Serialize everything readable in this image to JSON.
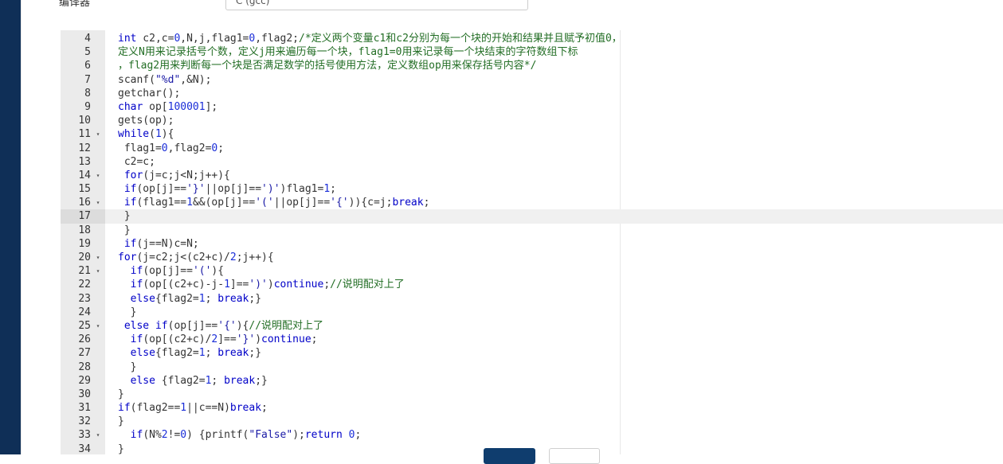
{
  "header": {
    "label": "编译器",
    "compiler_value": "C (gcc)"
  },
  "editor": {
    "active_line": "17",
    "lines": [
      {
        "n": "4",
        "fold": false,
        "html": "<span class=\"kw\">int</span> c2,c=<span class=\"num\">0</span>,N,j,flag1=<span class=\"num\">0</span>,flag2;<span class=\"cm\">/*定义两个变量c1和c2分别为每一个块的开始和结果并且赋予初值0，</span>"
      },
      {
        "n": "5",
        "fold": false,
        "html": "<span class=\"cm\">定义N用来记录括号个数，定义j用来遍历每一个块，flag1=0用来记录每一个块结束的字符数组下标</span>"
      },
      {
        "n": "6",
        "fold": false,
        "html": "<span class=\"cm\">，flag2用来判断每一个块是否满足数学的括号使用方法，定义数组op用来保存括号内容*/</span>"
      },
      {
        "n": "7",
        "fold": false,
        "html": "scanf(<span class=\"str\">\"%d\"</span>,&amp;N);"
      },
      {
        "n": "8",
        "fold": false,
        "html": "getchar();"
      },
      {
        "n": "9",
        "fold": false,
        "html": "<span class=\"kw\">char</span> op[<span class=\"num\">100001</span>];"
      },
      {
        "n": "10",
        "fold": false,
        "html": "gets(op);"
      },
      {
        "n": "11",
        "fold": true,
        "html": "<span class=\"kw\">while</span>(<span class=\"num\">1</span>){"
      },
      {
        "n": "12",
        "fold": false,
        "html": " flag1=<span class=\"num\">0</span>,flag2=<span class=\"num\">0</span>;"
      },
      {
        "n": "13",
        "fold": false,
        "html": " c2=c;"
      },
      {
        "n": "14",
        "fold": true,
        "html": " <span class=\"kw\">for</span>(j=c;j&lt;N;j++){"
      },
      {
        "n": "15",
        "fold": false,
        "html": " <span class=\"kw\">if</span>(op[j]==<span class=\"str\">'}'</span>||op[j]==<span class=\"str\">')'</span>)flag1=<span class=\"num\">1</span>;"
      },
      {
        "n": "16",
        "fold": true,
        "html": " <span class=\"kw\">if</span>(flag1==<span class=\"num\">1</span>&amp;&amp;(op[j]==<span class=\"str\">'('</span>||op[j]==<span class=\"str\">'{'</span>)){c=j;<span class=\"kw\">break</span>;"
      },
      {
        "n": "17",
        "fold": false,
        "html": " }"
      },
      {
        "n": "18",
        "fold": false,
        "html": " }"
      },
      {
        "n": "19",
        "fold": false,
        "html": " <span class=\"kw\">if</span>(j==N)c=N;"
      },
      {
        "n": "20",
        "fold": true,
        "html": "<span class=\"kw\">for</span>(j=c2;j&lt;(c2+c)/<span class=\"num\">2</span>;j++){"
      },
      {
        "n": "21",
        "fold": true,
        "html": "  <span class=\"kw\">if</span>(op[j]==<span class=\"str\">'('</span>){"
      },
      {
        "n": "22",
        "fold": false,
        "html": "  <span class=\"kw\">if</span>(op[(c2+c)-j-<span class=\"num\">1</span>]==<span class=\"str\">')'</span>)<span class=\"kw\">continue</span>;<span class=\"cm\">//说明配对上了</span>"
      },
      {
        "n": "23",
        "fold": false,
        "html": "  <span class=\"kw\">else</span>{flag2=<span class=\"num\">1</span>; <span class=\"kw\">break</span>;}"
      },
      {
        "n": "24",
        "fold": false,
        "html": "  }"
      },
      {
        "n": "25",
        "fold": true,
        "html": " <span class=\"kw\">else</span> <span class=\"kw\">if</span>(op[j]==<span class=\"str\">'{'</span>){<span class=\"cm\">//说明配对上了</span>"
      },
      {
        "n": "26",
        "fold": false,
        "html": "  <span class=\"kw\">if</span>(op[(c2+c)/<span class=\"num\">2</span>]==<span class=\"str\">'}'</span>)<span class=\"kw\">continue</span>;"
      },
      {
        "n": "27",
        "fold": false,
        "html": "  <span class=\"kw\">else</span>{flag2=<span class=\"num\">1</span>; <span class=\"kw\">break</span>;}"
      },
      {
        "n": "28",
        "fold": false,
        "html": "  }"
      },
      {
        "n": "29",
        "fold": false,
        "html": "  <span class=\"kw\">else</span> {flag2=<span class=\"num\">1</span>; <span class=\"kw\">break</span>;}"
      },
      {
        "n": "30",
        "fold": false,
        "html": "}"
      },
      {
        "n": "31",
        "fold": false,
        "html": "<span class=\"kw\">if</span>(flag2==<span class=\"num\">1</span>||c==N)<span class=\"kw\">break</span>;"
      },
      {
        "n": "32",
        "fold": false,
        "html": "}"
      },
      {
        "n": "33",
        "fold": true,
        "html": "  <span class=\"kw\">if</span>(N%<span class=\"num\">2</span>!=<span class=\"num\">0</span>) {printf(<span class=\"str\">\"False\"</span>);<span class=\"kw\">return</span> <span class=\"num\">0</span>;"
      },
      {
        "n": "34",
        "fold": false,
        "html": "}"
      }
    ]
  },
  "icons": {
    "fold": "fold-arrow-icon"
  },
  "colors": {
    "sidebar": "#0f2f57",
    "keyword": "#0000c8",
    "comment": "#236e25",
    "string": "#1a1aa6",
    "primary_button": "#0f3d6e"
  }
}
